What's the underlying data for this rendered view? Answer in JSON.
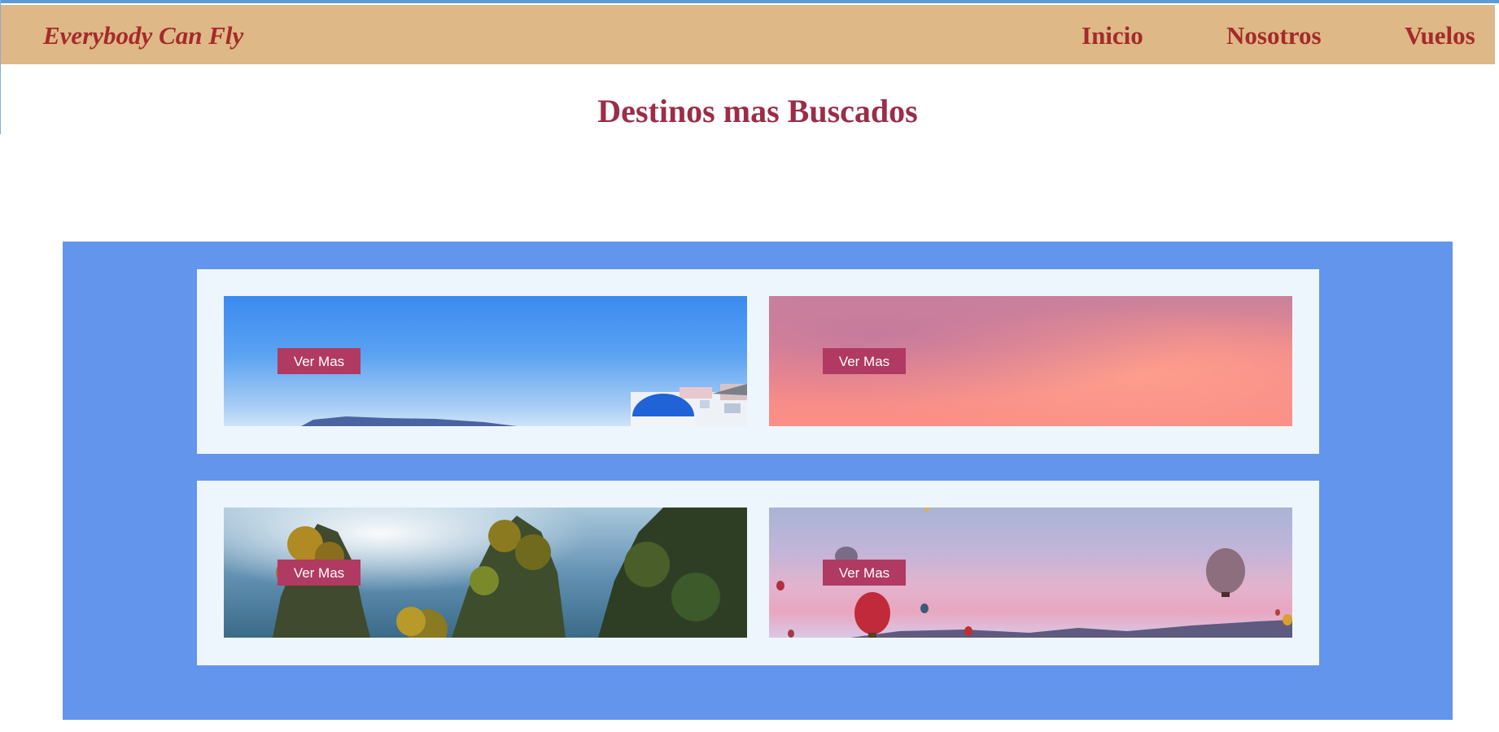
{
  "navbar": {
    "brand": "Everybody Can Fly",
    "links": [
      "Inicio",
      "Nosotros",
      "Vuelos"
    ]
  },
  "page_title": "Destinos mas Buscados",
  "cards": {
    "button_label": "Ver Mas"
  },
  "colors": {
    "navbar_bg": "#deb887",
    "brand_text": "#a52a2a",
    "title_text": "#9b2d48",
    "panel_bg": "#6495ed",
    "card_bg": "#eef6fd",
    "button_bg": "#b03a62"
  }
}
